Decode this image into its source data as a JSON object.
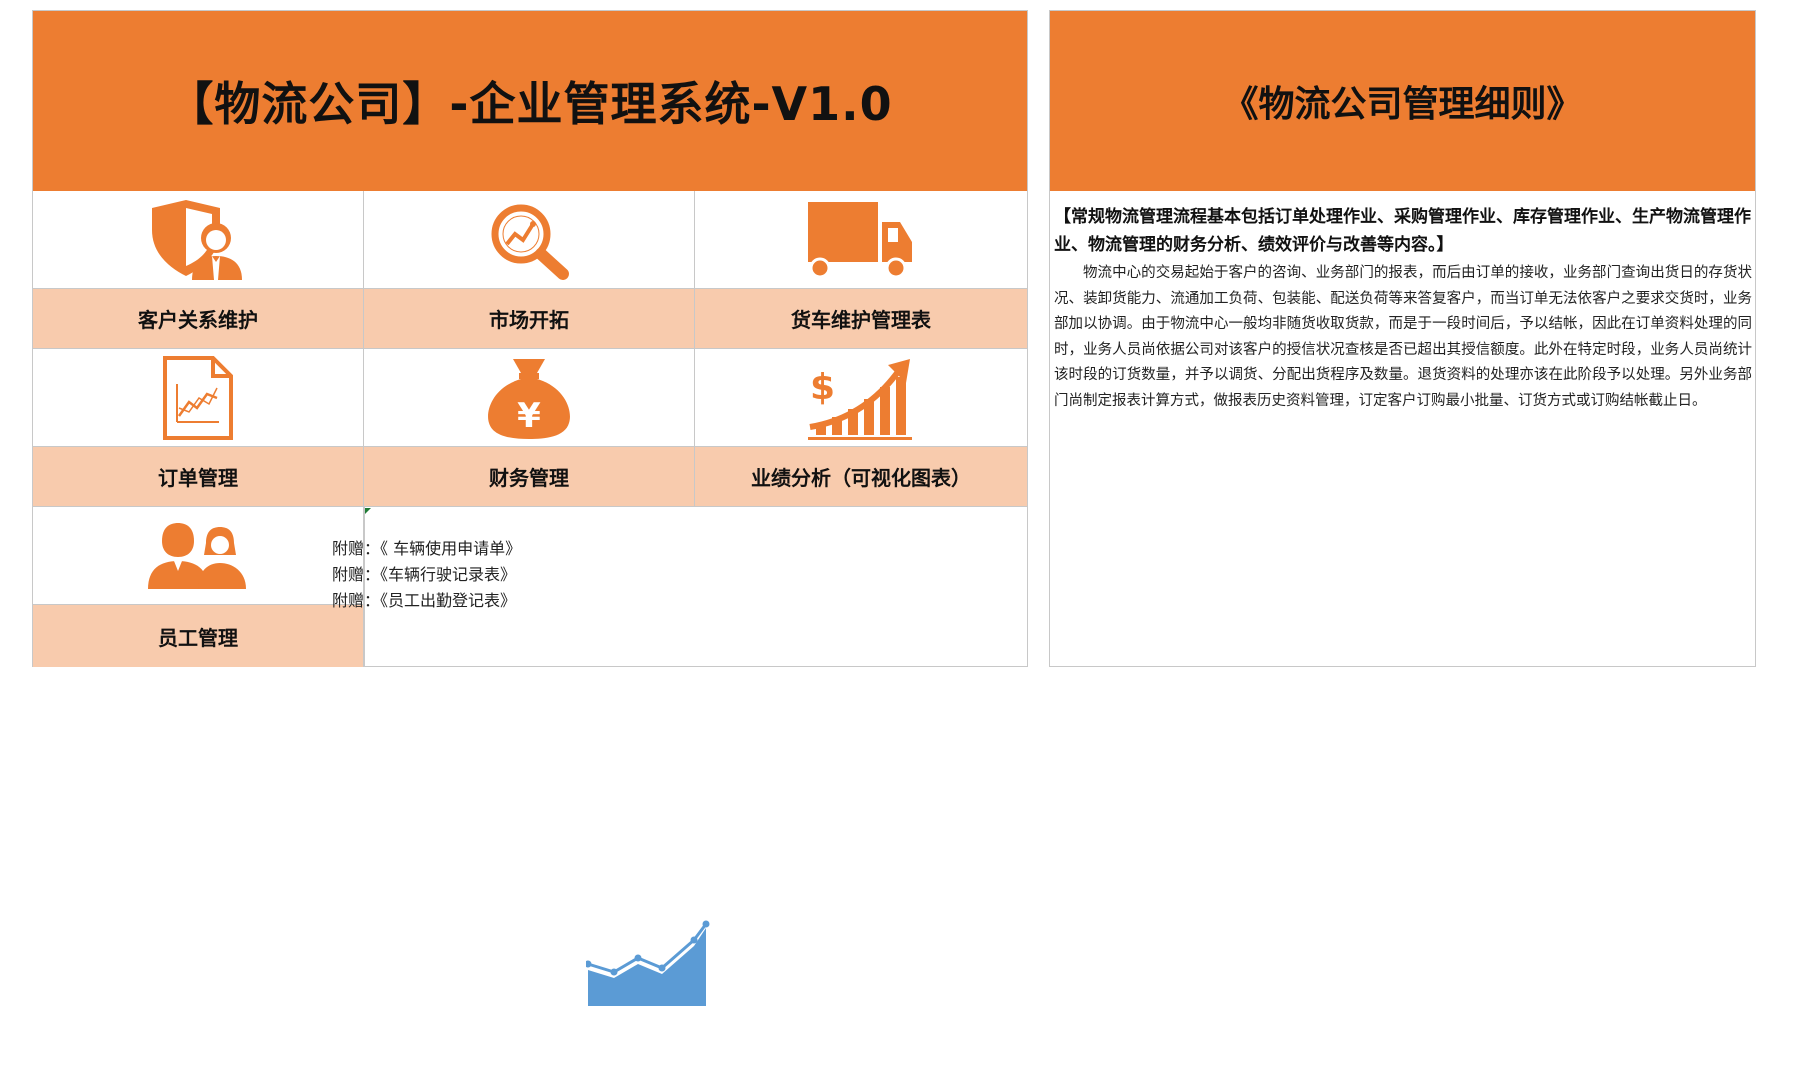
{
  "left": {
    "title": "【物流公司】-企业管理系统-V1.0",
    "tiles": [
      {
        "label": "客户关系维护",
        "icon": "shield-user-icon"
      },
      {
        "label": "市场开拓",
        "icon": "magnifier-chart-icon"
      },
      {
        "label": "货车维护管理表",
        "icon": "truck-icon"
      },
      {
        "label": "订单管理",
        "icon": "document-chart-icon"
      },
      {
        "label": "财务管理",
        "icon": "money-bag-yen-icon"
      },
      {
        "label": "业绩分析（可视化图表）",
        "icon": "dollar-growth-icon"
      },
      {
        "label": "员工管理",
        "icon": "people-icon"
      }
    ],
    "appendix": [
      "附赠：《 车辆使用申请单》",
      "附赠：《车辆行驶记录表》",
      "附赠：《员工出勤登记表》"
    ]
  },
  "right": {
    "title": "《物流公司管理细则》",
    "heading": "【常规物流管理流程基本包括订单处理作业、采购管理作业、库存管理作业、生产物流管理作业、物流管理的财务分析、绩效评价与改善等内容。】",
    "body": "物流中心的交易起始于客户的咨询、业务部门的报表，而后由订单的接收，业务部门查询出货日的存货状况、装卸货能力、流通加工负荷、包装能、配送负荷等来答复客户，而当订单无法依客户之要求交货时，业务部加以协调。由于物流中心一般均非随货收取货款，而是于一段时间后，予以结帐，因此在订单资料处理的同时，业务人员尚依据公司对该客户的授信状况查核是否已超出其授信额度。此外在特定时段，业务人员尚统计该时段的订货数量，并予以调货、分配出货程序及数量。退货资料的处理亦该在此阶段予以处理。另外业务部门尚制定报表计算方式，做报表历史资料管理，订定客户订购最小批量、订货方式或订购结帐截止日。"
  },
  "colors": {
    "accent": "#ed7d31",
    "label_bg": "#f8cbad",
    "chart_icon": "#5b9bd5"
  },
  "floating_icon": "line-chart-icon"
}
